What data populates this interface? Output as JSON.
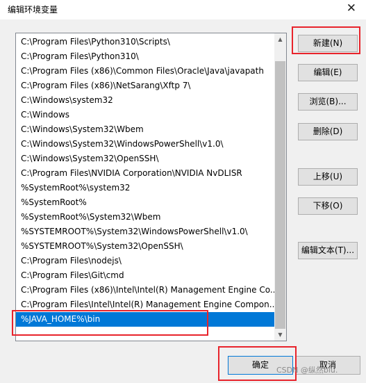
{
  "window": {
    "title": "编辑环境变量",
    "close_glyph": "✕"
  },
  "path_list": {
    "entries": [
      "C:\\Program Files\\Python310\\Scripts\\",
      "C:\\Program Files\\Python310\\",
      "C:\\Program Files (x86)\\Common Files\\Oracle\\Java\\javapath",
      "C:\\Program Files (x86)\\NetSarang\\Xftp 7\\",
      "C:\\Windows\\system32",
      "C:\\Windows",
      "C:\\Windows\\System32\\Wbem",
      "C:\\Windows\\System32\\WindowsPowerShell\\v1.0\\",
      "C:\\Windows\\System32\\OpenSSH\\",
      "C:\\Program Files\\NVIDIA Corporation\\NVIDIA NvDLISR",
      "%SystemRoot%\\system32",
      "%SystemRoot%",
      "%SystemRoot%\\System32\\Wbem",
      "%SYSTEMROOT%\\System32\\WindowsPowerShell\\v1.0\\",
      "%SYSTEMROOT%\\System32\\OpenSSH\\",
      "C:\\Program Files\\nodejs\\",
      "C:\\Program Files\\Git\\cmd",
      "C:\\Program Files (x86)\\Intel\\Intel(R) Management Engine Co...",
      "C:\\Program Files\\Intel\\Intel(R) Management Engine Compon...",
      "%JAVA_HOME%\\bin"
    ],
    "selected_entry": "%JAVA_HOME%\\bin",
    "scroll_up_glyph": "▲",
    "scroll_down_glyph": "▼"
  },
  "buttons": {
    "new": "新建(N)",
    "edit": "编辑(E)",
    "browse": "浏览(B)...",
    "delete": "删除(D)",
    "move_up": "上移(U)",
    "move_down": "下移(O)",
    "edit_text": "编辑文本(T)...",
    "ok": "确定",
    "cancel": "取消"
  },
  "watermark": "CSDN @纵然biu.",
  "colors": {
    "selection": "#0078d7",
    "highlight_box": "#e8232b"
  }
}
